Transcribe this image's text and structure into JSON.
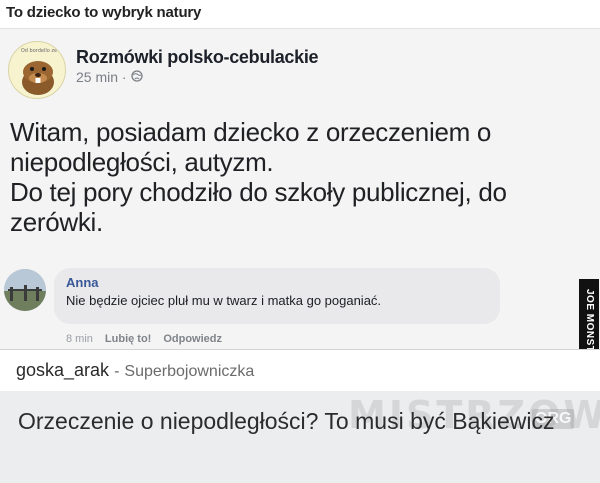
{
  "meme": {
    "title": "To dziecko to wybryk natury"
  },
  "post": {
    "avatar_caption": "Od bordello ze",
    "page_name": "Rozmówki polsko-cebulackie",
    "time": "25 min ·",
    "privacy_icon": "globe-icon",
    "body_lines": [
      "Witam, posiadam dziecko z orzeczeniem o",
      "niepodległości, autyzm.",
      "Do tej pory chodziło do szkoły publicznej, do",
      "zerówki."
    ]
  },
  "comment": {
    "author": "Anna",
    "text": "Nie będzie ojciec pluł mu w twarz i matka go poganiać.",
    "time": "8 min",
    "like_label": "Lubię to!",
    "reply_label": "Odpowiedz"
  },
  "side_watermark": "JOE MONSTER",
  "reply": {
    "username": "goska_arak",
    "separator": "-",
    "rank": "Superbojowniczka",
    "text": "Orzeczenie o niepodległości? To musi być Bąkiewicz",
    "watermark": "MISTRZOWIE",
    "watermark_suffix": "ORG"
  },
  "colors": {
    "page_name": "#1d2129",
    "comment_author": "#385898",
    "reply_background": "#ecedef"
  }
}
